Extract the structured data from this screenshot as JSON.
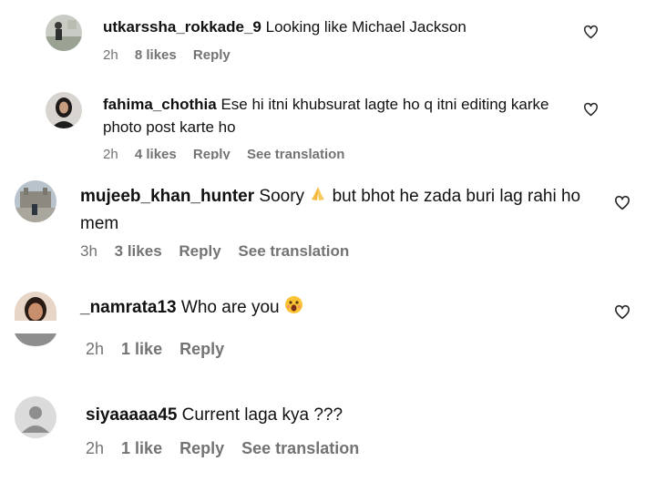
{
  "comments": [
    {
      "username": "utkarssha_rokkade_9",
      "text": "Looking like Michael Jackson",
      "time": "2h",
      "likes": "8 likes",
      "reply": "Reply",
      "translation": ""
    },
    {
      "username": "fahima_chothia",
      "text": "Ese hi itni khubsurat lagte ho q itni editing karke photo post karte ho",
      "time": "2h",
      "likes": "4 likes",
      "reply": "Reply",
      "translation": "See translation"
    },
    {
      "username": "mujeeb_khan_hunter",
      "text_before": "Soory",
      "text_after": "but bhot he zada buri lag rahi ho mem",
      "time": "3h",
      "likes": "3 likes",
      "reply": "Reply",
      "translation": "See translation"
    },
    {
      "username": "_namrata13",
      "text": "Who are you",
      "time": "2h",
      "likes": "1 like",
      "reply": "Reply",
      "translation": ""
    },
    {
      "username": "siyaaaaa45",
      "text": "Current laga kya ???",
      "time": "2h",
      "likes": "1 like",
      "reply": "Reply",
      "translation": "See translation"
    }
  ],
  "icons": {
    "like": "heart-outline-icon",
    "emoji_pray": "folded-hands-emoji",
    "emoji_shock": "shocked-face-emoji"
  },
  "colors": {
    "text": "#111111",
    "meta": "#737373",
    "placeholder_avatar": "#dbdbdb"
  }
}
